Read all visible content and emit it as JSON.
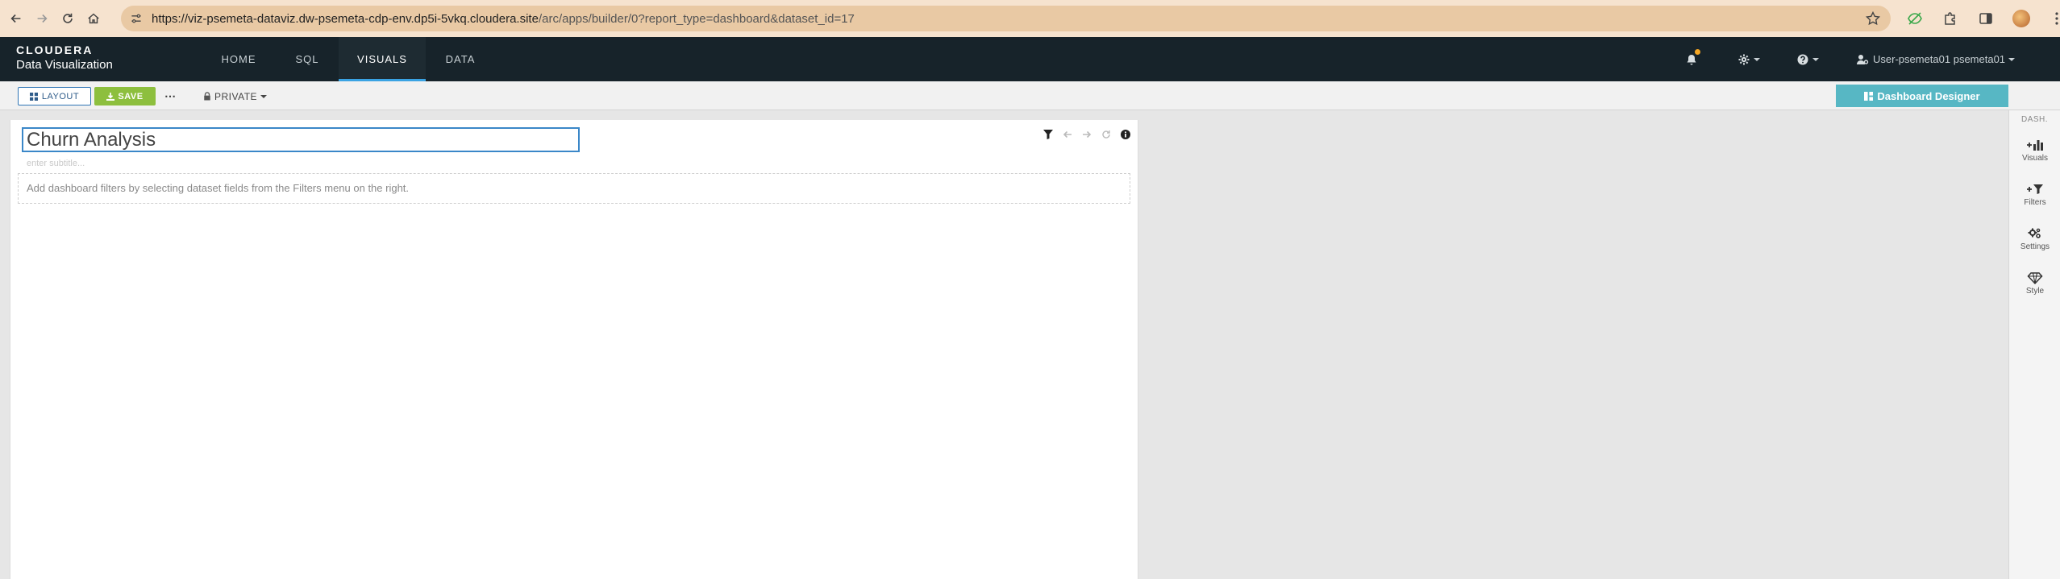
{
  "browser": {
    "url_host": "https://viz-psemeta-dataviz.dw-psemeta-cdp-env.dp5i-5vkq.cloudera.site",
    "url_path": "/arc/apps/builder/0?report_type=dashboard&dataset_id=17"
  },
  "app": {
    "logo": "CLOUDERA",
    "product": "Data Visualization",
    "nav": [
      {
        "label": "HOME",
        "active": false
      },
      {
        "label": "SQL",
        "active": false
      },
      {
        "label": "VISUALS",
        "active": true
      },
      {
        "label": "DATA",
        "active": false
      }
    ],
    "user_label": "User-psemeta01 psemeta01",
    "accent": "#3aa3e3"
  },
  "toolbar": {
    "layout_label": "LAYOUT",
    "save_label": "SAVE",
    "more_label": "⋯",
    "private_label": "PRIVATE",
    "designer_label": "Dashboard Designer"
  },
  "dashboard": {
    "title": "Churn Analysis",
    "subtitle_placeholder": "enter subtitle...",
    "filter_hint": "Add dashboard filters by selecting dataset fields from the Filters menu on the right."
  },
  "rail": {
    "heading": "DASH.",
    "items": [
      {
        "label": "Visuals",
        "icon": "add-chart-icon"
      },
      {
        "label": "Filters",
        "icon": "add-filter-icon"
      },
      {
        "label": "Settings",
        "icon": "cogs-icon"
      },
      {
        "label": "Style",
        "icon": "diamond-icon"
      }
    ]
  }
}
